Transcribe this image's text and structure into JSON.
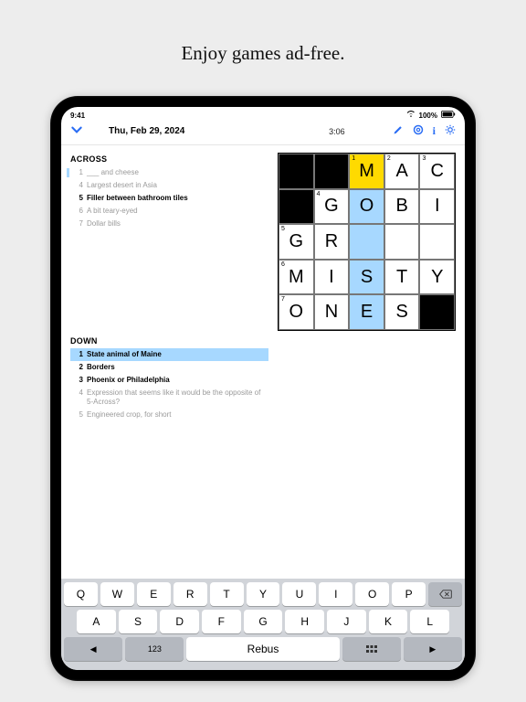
{
  "headline": "Enjoy games ad-free.",
  "status": {
    "time": "9:41",
    "battery": "100%"
  },
  "toolbar": {
    "date": "Thu, Feb 29, 2024",
    "timer": "3:06"
  },
  "clues": {
    "across_title": "ACROSS",
    "down_title": "DOWN",
    "across": [
      {
        "num": "1",
        "text": "___ and cheese",
        "state": "faded barred"
      },
      {
        "num": "4",
        "text": "Largest desert in Asia",
        "state": "faded"
      },
      {
        "num": "5",
        "text": "Filler between bathroom tiles",
        "state": "bold"
      },
      {
        "num": "6",
        "text": "A bit teary-eyed",
        "state": "faded"
      },
      {
        "num": "7",
        "text": "Dollar bills",
        "state": "faded"
      }
    ],
    "down": [
      {
        "num": "1",
        "text": "State animal of Maine",
        "state": "current"
      },
      {
        "num": "2",
        "text": "Borders",
        "state": "bold"
      },
      {
        "num": "3",
        "text": "Phoenix or Philadelphia",
        "state": "bold"
      },
      {
        "num": "4",
        "text": "Expression that seems like it would be the opposite of 5-Across?",
        "state": "faded"
      },
      {
        "num": "5",
        "text": "Engineered crop, for short",
        "state": "faded"
      }
    ]
  },
  "grid": {
    "cells": [
      {
        "black": true
      },
      {
        "black": true
      },
      {
        "num": "1",
        "v": "M",
        "focus": true
      },
      {
        "num": "2",
        "v": "A"
      },
      {
        "num": "3",
        "v": "C"
      },
      {
        "black": true
      },
      {
        "num": "4",
        "v": "G"
      },
      {
        "v": "O",
        "hl": true
      },
      {
        "v": "B"
      },
      {
        "v": "I"
      },
      {
        "num": "5",
        "v": "G"
      },
      {
        "v": "R"
      },
      {
        "v": "",
        "hl": true
      },
      {
        "v": ""
      },
      {
        "v": ""
      },
      {
        "num": "6",
        "v": "M"
      },
      {
        "v": "I"
      },
      {
        "v": "S",
        "hl": true
      },
      {
        "v": "T"
      },
      {
        "v": "Y"
      },
      {
        "num": "7",
        "v": "O"
      },
      {
        "v": "N"
      },
      {
        "v": "E",
        "hl": true
      },
      {
        "v": "S"
      },
      {
        "black": true
      }
    ]
  },
  "keyboard": {
    "row1": [
      "Q",
      "W",
      "E",
      "R",
      "T",
      "Y",
      "U",
      "I",
      "O",
      "P"
    ],
    "row2": [
      "A",
      "S",
      "D",
      "F",
      "G",
      "H",
      "J",
      "K",
      "L"
    ],
    "row3_left": "◀",
    "row3_right": "▶",
    "bottom_123": "123",
    "bottom_rebus": "Rebus",
    "bottom_more": "More"
  }
}
